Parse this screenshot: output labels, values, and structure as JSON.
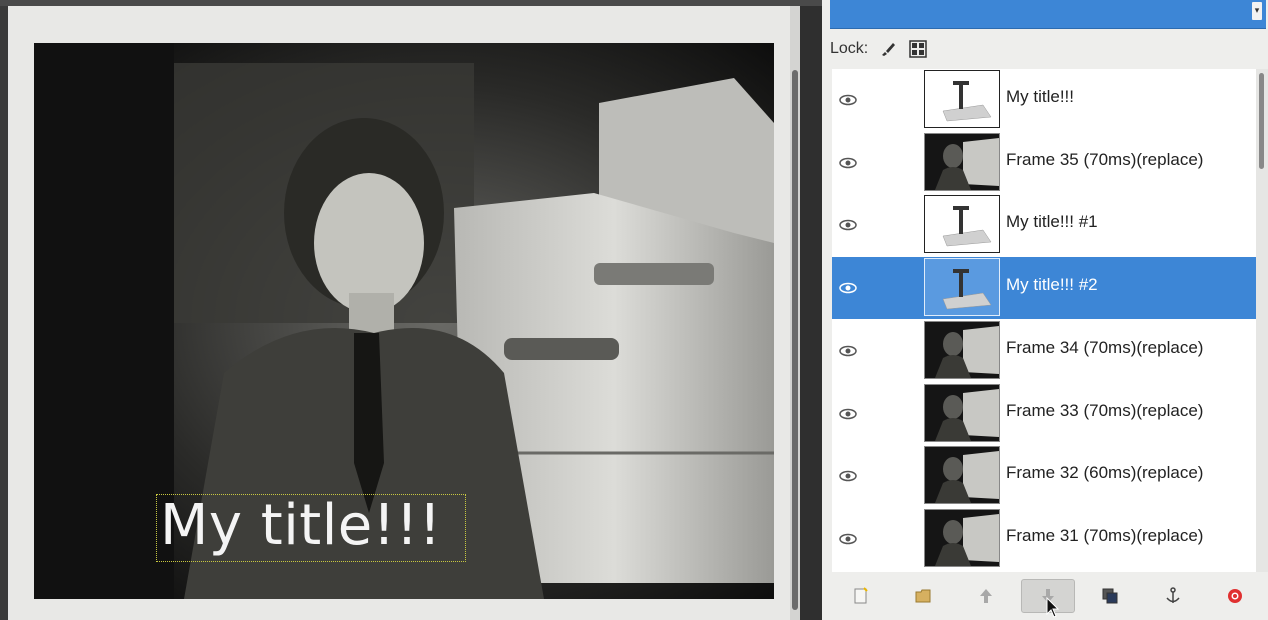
{
  "canvas": {
    "overlay_text": "My title!!!"
  },
  "layers_panel": {
    "lock_label": "Lock:",
    "lock_icons": [
      "brush-lock-icon",
      "alpha-lock-icon"
    ],
    "layers": [
      {
        "name": "My title!!!",
        "type": "text",
        "visible": true,
        "selected": false
      },
      {
        "name": "Frame 35  (70ms)(replace)",
        "type": "frame",
        "visible": true,
        "selected": false
      },
      {
        "name": "My title!!! #1",
        "type": "text",
        "visible": true,
        "selected": false
      },
      {
        "name": "My title!!! #2",
        "type": "text",
        "visible": true,
        "selected": true
      },
      {
        "name": "Frame 34  (70ms)(replace)",
        "type": "frame",
        "visible": true,
        "selected": false
      },
      {
        "name": "Frame 33  (70ms)(replace)",
        "type": "frame",
        "visible": true,
        "selected": false
      },
      {
        "name": "Frame 32  (60ms)(replace)",
        "type": "frame",
        "visible": true,
        "selected": false
      },
      {
        "name": "Frame 31  (70ms)(replace)",
        "type": "frame",
        "visible": true,
        "selected": false
      }
    ],
    "toolbar": [
      {
        "icon": "new-layer-icon",
        "pressed": false
      },
      {
        "icon": "new-layer-group-icon",
        "pressed": false
      },
      {
        "icon": "raise-layer-icon",
        "pressed": false
      },
      {
        "icon": "lower-layer-icon",
        "pressed": true
      },
      {
        "icon": "duplicate-layer-icon",
        "pressed": false
      },
      {
        "icon": "anchor-layer-icon",
        "pressed": false
      },
      {
        "icon": "delete-layer-icon",
        "pressed": false
      }
    ]
  },
  "colors": {
    "selection": "#3d86d6",
    "panel_bg": "#eeeeec"
  }
}
